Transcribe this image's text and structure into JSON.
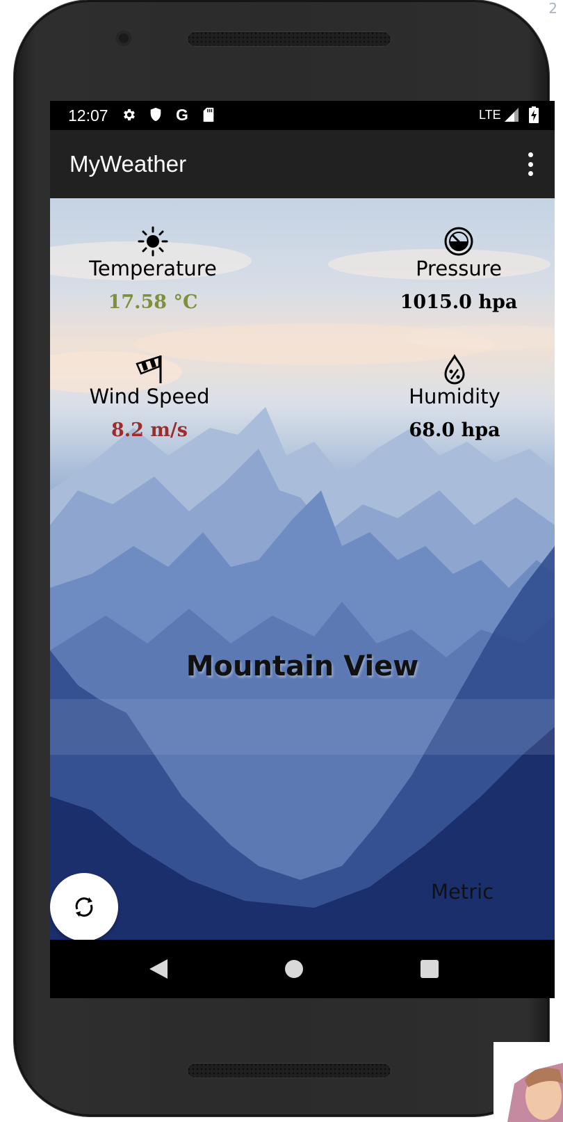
{
  "corner_number": "2",
  "status_bar": {
    "time": "12:07",
    "network": "LTE",
    "icons": [
      "gear-icon",
      "shield-icon",
      "google-icon",
      "sd-card-icon",
      "signal-icon",
      "battery-icon"
    ]
  },
  "app_bar": {
    "title": "MyWeather",
    "menu_icon": "overflow-menu-icon"
  },
  "weather": {
    "temperature": {
      "label": "Temperature",
      "value": "17.58 °C",
      "icon": "sun-icon",
      "value_color": "#7f8f3a"
    },
    "pressure": {
      "label": "Pressure",
      "value": "1015.0 hpa",
      "icon": "gauge-icon",
      "value_color": "#000000"
    },
    "wind": {
      "label": "Wind Speed",
      "value": "8.2 m/s",
      "icon": "windsock-icon",
      "value_color": "#9b2d2d"
    },
    "humidity": {
      "label": "Humidity",
      "value": "68.0 hpa",
      "icon": "humidity-drop-icon",
      "value_color": "#000000"
    }
  },
  "city": "Mountain View",
  "units": "Metric",
  "fab_icon": "refresh-icon",
  "nav": [
    "back-icon",
    "home-icon",
    "recents-icon"
  ],
  "colors": {
    "app_bar": "#212121",
    "status_bar": "#000000",
    "fab": "#ffffff"
  }
}
